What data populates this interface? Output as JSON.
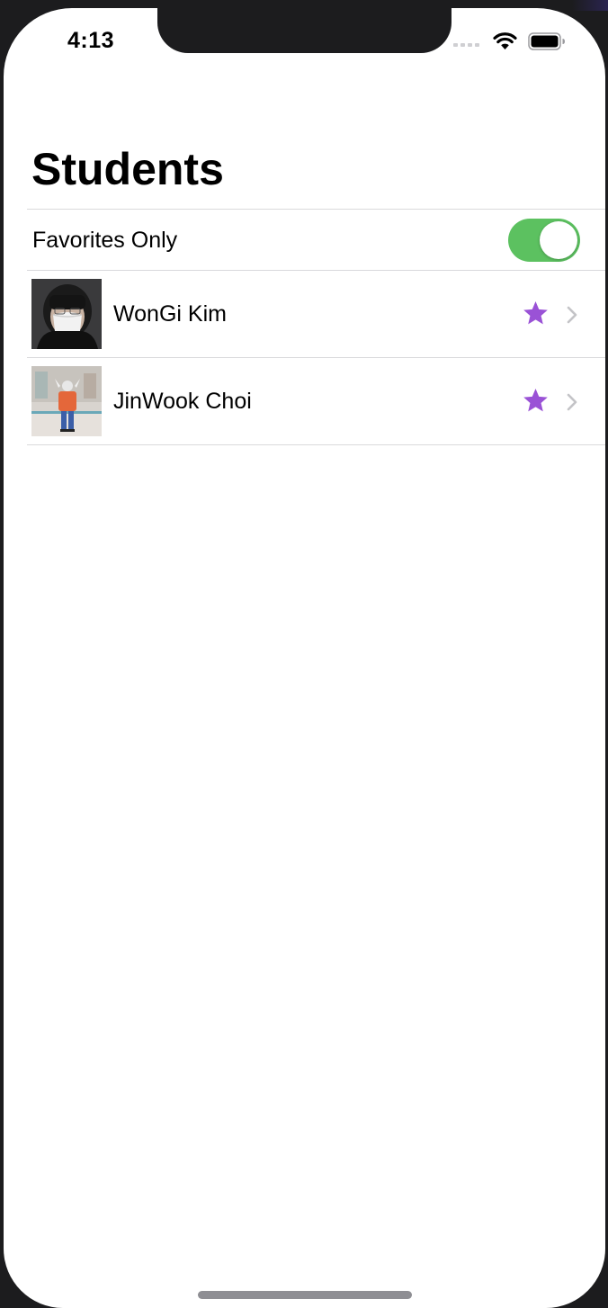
{
  "status_bar": {
    "time": "4:13",
    "signal_icon": "cellular-signal-icon",
    "wifi_icon": "wifi-icon",
    "battery_icon": "battery-icon"
  },
  "nav": {
    "title": "Students"
  },
  "filter": {
    "label": "Favorites Only",
    "enabled": true
  },
  "students": [
    {
      "name": "WonGi Kim",
      "favorite": true
    },
    {
      "name": "JinWook Choi",
      "favorite": true
    }
  ],
  "colors": {
    "toggle_on": "#5cc160",
    "favorite_star": "#9a52d6",
    "chevron": "#c4c4c7"
  }
}
